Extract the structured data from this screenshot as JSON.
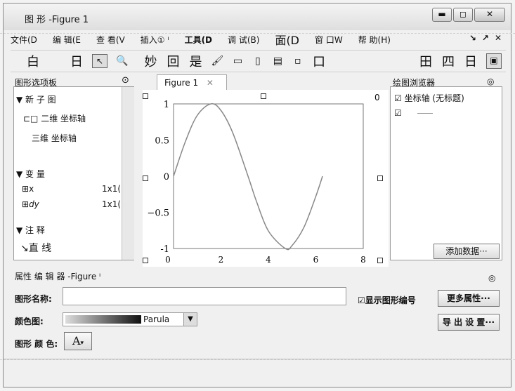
{
  "window": {
    "title": "图 形 -Figure   1",
    "buttons": [
      "▬",
      "◻",
      "✕"
    ]
  },
  "menu": {
    "items": [
      "文件(D",
      "编  辑(E",
      "查  看(V",
      "插入①  ᴵ",
      "工具(D",
      "调  试(B)",
      "面(D",
      "窗  口W",
      "帮  助(H)"
    ],
    "right": [
      "↘",
      "↗",
      "✕"
    ]
  },
  "toolbar": {
    "items": [
      "白",
      "日",
      "↖",
      "🔍",
      "妙",
      "回",
      "是",
      "🖌",
      "▭",
      "▯",
      "▤",
      "▫",
      "口",
      "田",
      "四",
      "日",
      "▣"
    ]
  },
  "palette": {
    "title": "图形选项板",
    "new_subplot": "▼ 新 子 图",
    "axes2d": "⊏□ 二维 坐标轴",
    "axes3d": "三维 坐标轴",
    "variables": "▼  变  量",
    "vars": [
      {
        "name": "x",
        "value": "1x1("
      },
      {
        "name": "dy",
        "value": "1x1("
      }
    ],
    "annotations": "▼ 注  释",
    "line_item": "直  线"
  },
  "figure": {
    "tab_label": "Figure   1",
    "tab_close": "✕",
    "corner_zero": "0"
  },
  "chart_data": {
    "type": "line",
    "xlim": [
      0,
      8
    ],
    "ylim": [
      -1,
      1
    ],
    "xticks": [
      "0",
      "2",
      "4",
      "6",
      "8"
    ],
    "yticks": [
      "1",
      "0.5",
      "0",
      "−0.5",
      "-1"
    ],
    "x": [
      0,
      0.5,
      1.0,
      1.5708,
      2.0,
      2.5,
      3.1416,
      3.5,
      4.0,
      4.7124,
      5.0,
      5.5,
      6.0,
      6.2832
    ],
    "y": [
      0,
      0.479,
      0.841,
      1.0,
      0.909,
      0.598,
      0,
      -0.351,
      -0.757,
      -1.0,
      -0.959,
      -0.706,
      -0.279,
      0
    ],
    "grid": false
  },
  "plot_browser": {
    "title": "绘图浏览器",
    "axes_item": "坐标轴 (无标题)",
    "add_data": "添加数据···"
  },
  "property_editor": {
    "title": "属性 编 辑 器 -Figure  ᴵ",
    "name_label": "图形名称:",
    "name_value": "",
    "show_number": "显示图形编号",
    "more_props": "更多属性···",
    "colormap_label": "颜色图:",
    "colormap_value": "Parula",
    "export_setup": "导 出 设 置···",
    "figure_color_label": "图形 颜 色:",
    "color_button": "A"
  }
}
